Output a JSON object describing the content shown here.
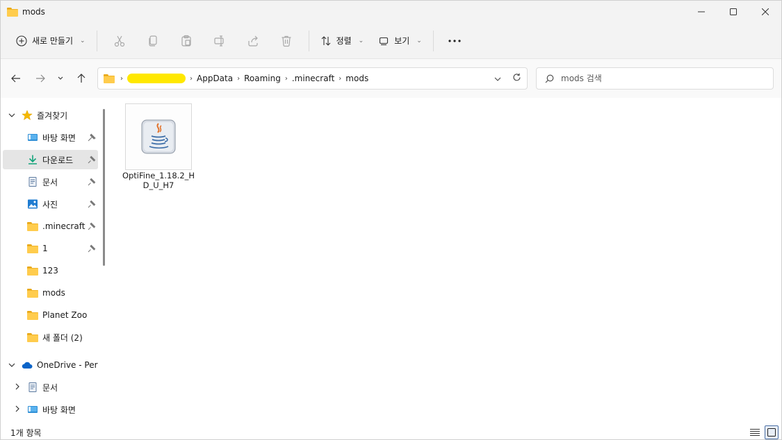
{
  "window": {
    "title": "mods",
    "controls": {
      "minimize": "minimize",
      "maximize": "maximize",
      "close": "close"
    }
  },
  "toolbar": {
    "new_label": "새로 만들기",
    "sort_label": "정렬",
    "view_label": "보기",
    "icons": [
      "cut-icon",
      "copy-icon",
      "paste-icon",
      "rename-icon",
      "share-icon",
      "delete-icon"
    ]
  },
  "address": {
    "breadcrumbs": [
      "AppData",
      "Roaming",
      ".minecraft",
      "mods"
    ]
  },
  "search": {
    "placeholder": "mods 검색"
  },
  "sidebar": {
    "items": [
      {
        "label": "즐겨찾기",
        "icon": "star-icon",
        "indent": 0,
        "expander": "expanded"
      },
      {
        "label": "바탕 화면",
        "icon": "desktop-icon",
        "indent": 1,
        "pinned": true
      },
      {
        "label": "다운로드",
        "icon": "download-icon",
        "indent": 1,
        "pinned": true,
        "selected": true
      },
      {
        "label": "문서",
        "icon": "document-icon",
        "indent": 1,
        "pinned": true
      },
      {
        "label": "사진",
        "icon": "pictures-icon",
        "indent": 1,
        "pinned": true
      },
      {
        "label": ".minecraft",
        "icon": "folder-icon",
        "indent": 1,
        "pinned": true
      },
      {
        "label": "1",
        "icon": "folder-icon",
        "indent": 1,
        "pinned": true
      },
      {
        "label": "123",
        "icon": "folder-icon",
        "indent": 1
      },
      {
        "label": "mods",
        "icon": "folder-icon",
        "indent": 1
      },
      {
        "label": "Planet Zoo",
        "icon": "folder-icon",
        "indent": 1
      },
      {
        "label": "새 폴더 (2)",
        "icon": "folder-icon",
        "indent": 1
      },
      {
        "label": "OneDrive - Perso",
        "icon": "cloud-icon",
        "indent": 0,
        "expander": "expanded"
      },
      {
        "label": "문서",
        "icon": "document-icon",
        "indent": 1,
        "expander": "collapsed"
      },
      {
        "label": "바탕 화면",
        "icon": "desktop-icon",
        "indent": 1,
        "expander": "collapsed"
      }
    ]
  },
  "files": [
    {
      "name": "OptiFine_1.18.2_HD_U_H7",
      "icon": "java-icon"
    }
  ],
  "status": {
    "item_count": "1개 항목"
  },
  "colors": {
    "accent": "#0067c0",
    "folder": "#ffcc4d",
    "star": "#f5b800",
    "redaction": "#ffe800"
  }
}
